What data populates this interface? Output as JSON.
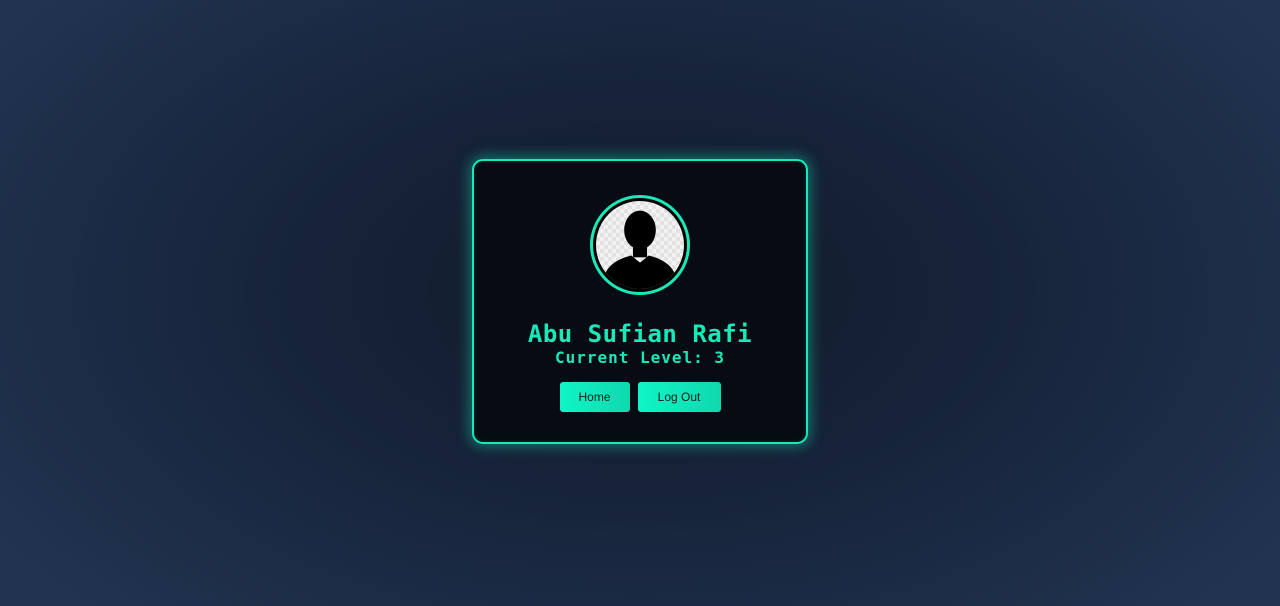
{
  "profile": {
    "name": "Abu Sufian Rafi",
    "level_text": "Current Level: 3",
    "avatar_icon": "user-silhouette-icon"
  },
  "actions": {
    "home_label": "Home",
    "logout_label": "Log Out"
  },
  "colors": {
    "accent": "#19e9b8",
    "card_background": "#070c14",
    "page_background": "#1c2b44"
  }
}
